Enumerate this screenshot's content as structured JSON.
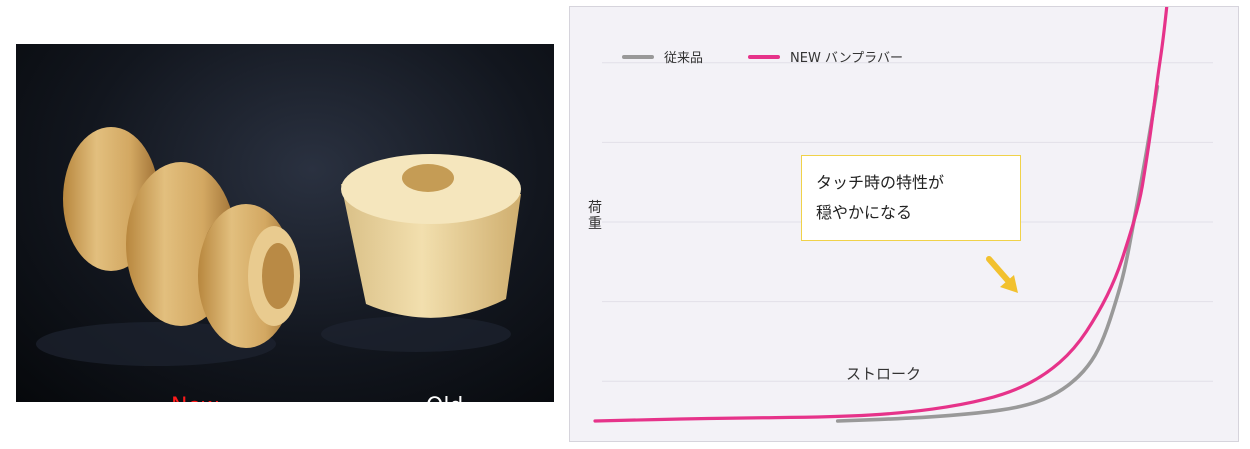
{
  "photo": {
    "labels": [
      {
        "text": "New",
        "color": "#ff1a1a"
      },
      {
        "text": "Old",
        "color": "#ffffff"
      }
    ]
  },
  "chart_data": {
    "type": "line",
    "xlabel": "ストローク",
    "ylabel": "荷重",
    "grid": true,
    "legend": "top-left",
    "xlim": [
      0,
      100
    ],
    "ylim": [
      0,
      100
    ],
    "series": [
      {
        "name": "従来品",
        "color": "#999999",
        "x": [
          41,
          55,
          65,
          72,
          77,
          81,
          84,
          86,
          88,
          89.5,
          91,
          92.5,
          94,
          95
        ],
        "y": [
          0,
          0.8,
          2,
          3.5,
          6,
          10,
          15,
          21,
          30,
          38,
          50,
          62,
          75,
          84
        ]
      },
      {
        "name": "NEW バンプラバー",
        "color": "#e6338a",
        "x": [
          0,
          20,
          41,
          52,
          62,
          70,
          76,
          81,
          85,
          88,
          90,
          92,
          93,
          94,
          95,
          96,
          97
        ],
        "y": [
          0,
          0.7,
          1,
          2,
          4,
          7,
          11.5,
          18,
          27,
          36,
          45,
          55,
          64,
          74,
          86,
          96,
          110
        ]
      }
    ],
    "annotation": {
      "lines": [
        "タッチ時の特性が",
        "穏やかになる"
      ],
      "arrow_color": "#f2c12e"
    }
  }
}
